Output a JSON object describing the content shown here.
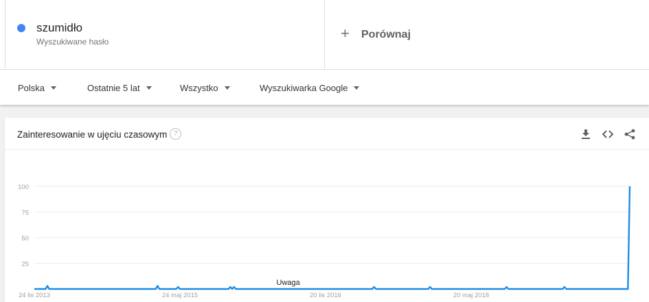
{
  "search_term": {
    "name": "szumidło",
    "subtitle": "Wyszukiwane hasło",
    "color": "#4285f4"
  },
  "compare": {
    "label": "Porównaj",
    "icon": "plus-icon"
  },
  "filters": [
    {
      "label": "Polska",
      "icon": "caret-down-icon"
    },
    {
      "label": "Ostatnie 5 lat",
      "icon": "caret-down-icon"
    },
    {
      "label": "Wszystko",
      "icon": "caret-down-icon"
    },
    {
      "label": "Wyszukiwarka Google",
      "icon": "caret-down-icon"
    }
  ],
  "card": {
    "title": "Zainteresowanie w ujęciu czasowym",
    "help_icon": "help-icon",
    "help_glyph": "?",
    "actions": [
      "download-icon",
      "embed-icon",
      "share-icon"
    ]
  },
  "chart_data": {
    "type": "line",
    "title": "",
    "xlabel": "",
    "ylabel": "",
    "ylim": [
      0,
      100
    ],
    "y_ticks": [
      25,
      50,
      75,
      100
    ],
    "grid": true,
    "x_tick_labels": [
      "24 lis 2013",
      "24 maj 2015",
      "20 lis 2016",
      "20 maj 2018"
    ],
    "annotations": [
      {
        "text": "Uwaga",
        "x_week": 136
      }
    ],
    "series": [
      {
        "color": "#1a8be6",
        "x_weeks_from_start": [
          0,
          6,
          7,
          8,
          65,
          66,
          67,
          76,
          77,
          78,
          104,
          105,
          106,
          107,
          108,
          181,
          182,
          183,
          211,
          212,
          213,
          252,
          253,
          254,
          283,
          284,
          285,
          317,
          318,
          319
        ],
        "values": [
          0,
          0,
          3,
          0,
          0,
          3,
          0,
          0,
          2,
          0,
          0,
          2,
          0,
          2,
          0,
          0,
          2,
          0,
          0,
          2,
          0,
          0,
          2,
          0,
          0,
          2,
          0,
          0,
          0,
          100
        ]
      }
    ]
  }
}
